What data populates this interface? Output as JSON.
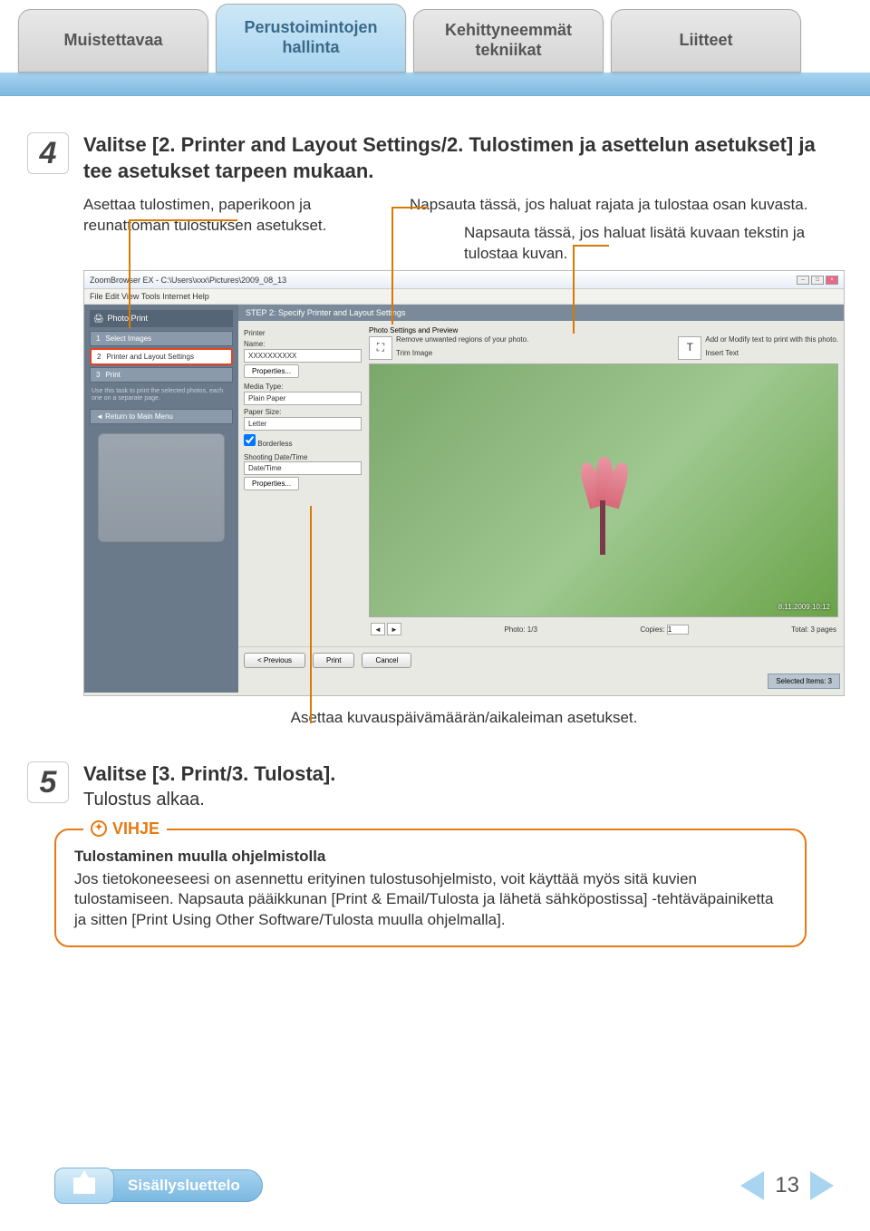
{
  "tabs": {
    "t1": "Muistettavaa",
    "t2": "Perustoimintojen hallinta",
    "t3": "Kehittyneemmät tekniikat",
    "t4": "Liitteet"
  },
  "step4": {
    "num": "4",
    "title": "Valitse [2. Printer and Layout Settings/2. Tulostimen ja asettelun asetukset] ja tee asetukset tarpeen mukaan.",
    "left_note": "Asettaa tulostimen, paperikoon ja reunattoman tulostuksen asetukset.",
    "right_note1": "Napsauta tässä, jos haluat rajata ja tulostaa osan kuvasta.",
    "right_note2": "Napsauta tässä, jos haluat lisätä kuvaan tekstin ja tulostaa kuvan."
  },
  "screenshot": {
    "title": "ZoomBrowser EX - C:\\Users\\xxx\\Pictures\\2009_08_13",
    "menu": "File   Edit   View   Tools   Internet   Help",
    "side": {
      "header": "Photo Print",
      "s1_num": "1",
      "s1": "Select Images",
      "s2_num": "2",
      "s2": "Printer and Layout Settings",
      "s3_num": "3",
      "s3": "Print",
      "note": "Use this task to print the selected photos, each one on a separate page.",
      "return": "Return to Main Menu"
    },
    "main_header": "STEP 2: Specify Printer and Layout Settings",
    "opts": {
      "printer_lbl": "Printer",
      "name_lbl": "Name:",
      "name_val": "XXXXXXXXXX",
      "properties": "Properties...",
      "media_lbl": "Media Type:",
      "media_val": "Plain Paper",
      "size_lbl": "Paper Size:",
      "size_val": "Letter",
      "borderless": "Borderless",
      "date_group": "Shooting Date/Time",
      "date_val": "Date/Time",
      "date_props": "Properties..."
    },
    "preview": {
      "header": "Photo Settings and Preview",
      "trim_txt": "Remove unwanted regions of your photo.",
      "trim_lbl": "Trim Image",
      "text_txt": "Add or Modify text to print with this photo.",
      "text_lbl": "Insert Text",
      "date": "8.11.2009   10:12",
      "photo_of": "Photo: 1/3",
      "copies_lbl": "Copies:",
      "copies_val": "1",
      "total": "Total: 3 pages"
    },
    "bottom": {
      "prev": "< Previous",
      "print": "Print",
      "cancel": "Cancel",
      "selected": "Selected Items: 3"
    }
  },
  "bottom_annot": "Asettaa kuvauspäivämäärän/aikaleiman asetukset.",
  "step5": {
    "num": "5",
    "title": "Valitse [3. Print/3. Tulosta].",
    "sub": "Tulostus alkaa."
  },
  "hint": {
    "label": "VIHJE",
    "title": "Tulostaminen muulla ohjelmistolla",
    "body": "Jos tietokoneeseesi on asennettu erityinen tulostusohjelmisto, voit käyttää myös sitä kuvien tulostamiseen. Napsauta pääikkunan [Print & Email/Tulosta ja lähetä sähköpostissa] -tehtäväpainiketta ja sitten [Print Using Other Software/Tulosta muulla ohjelmalla]."
  },
  "footer": {
    "toc": "Sisällysluettelo",
    "page": "13"
  }
}
